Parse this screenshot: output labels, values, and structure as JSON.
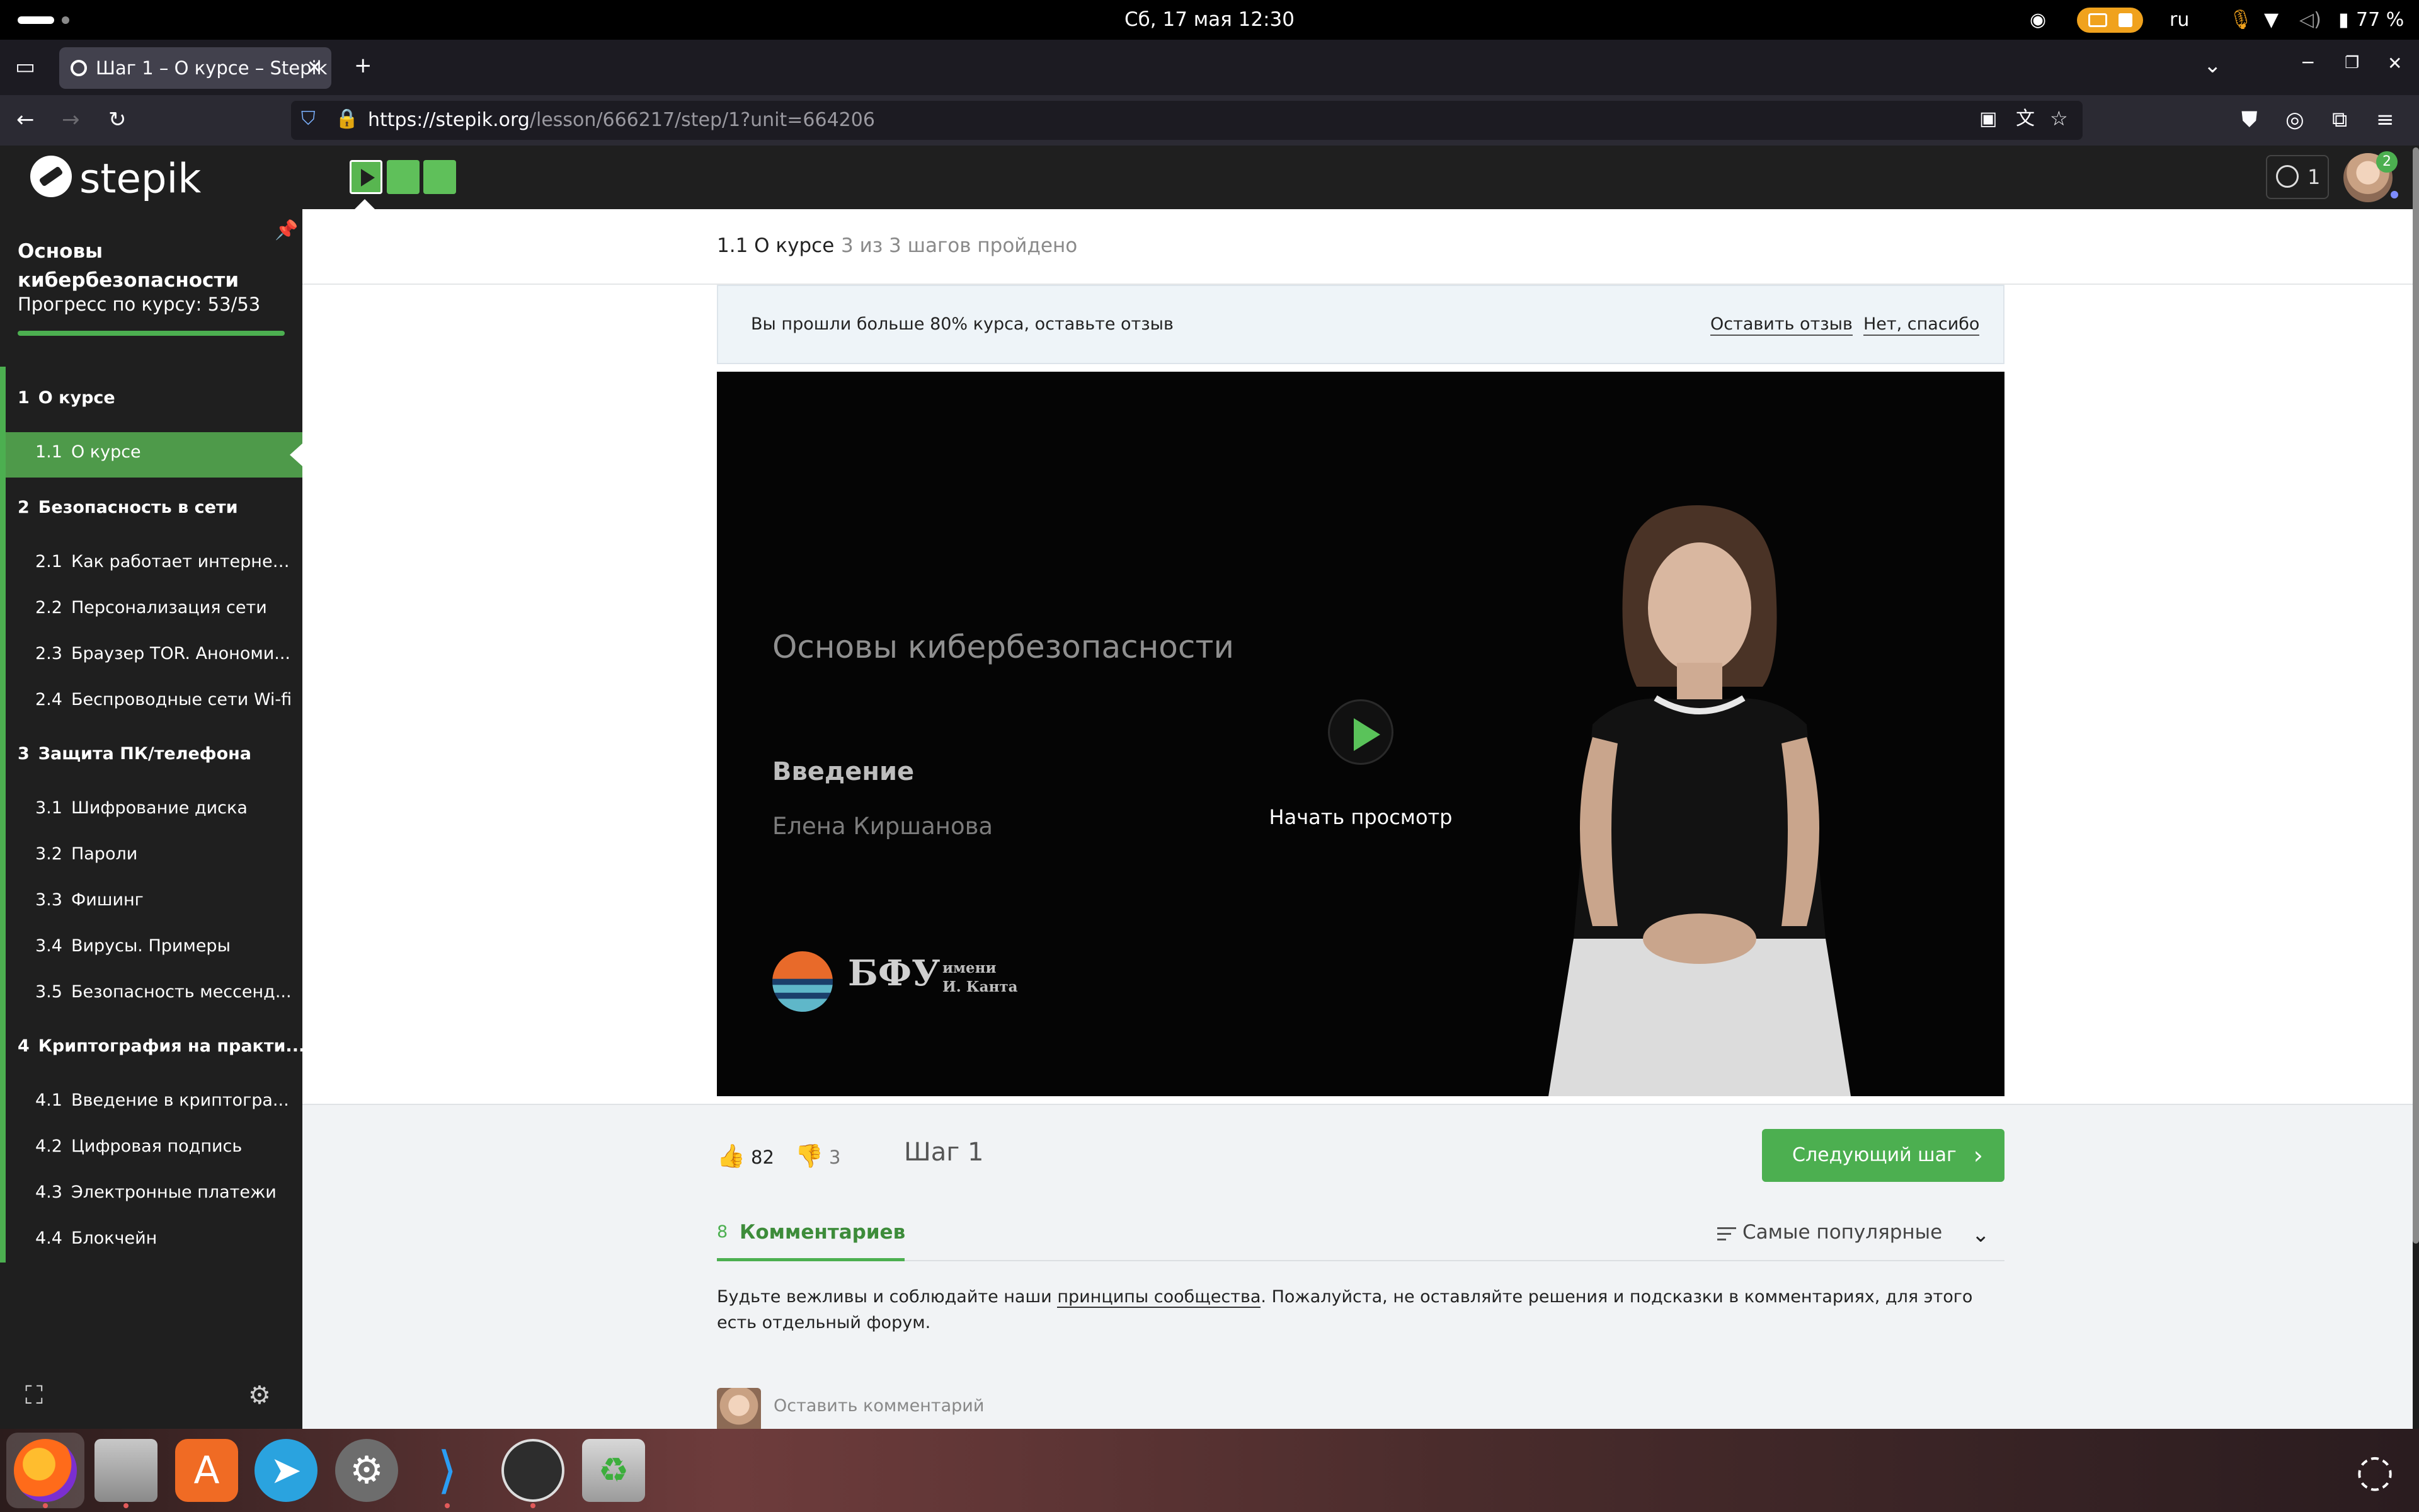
{
  "system": {
    "datetime": "Сб, 17 мая  12:30",
    "language": "ru",
    "battery": "77 %"
  },
  "browser": {
    "tab_title": "Шаг 1 – О курсе – Stepik",
    "url_domain": "https://stepik.org",
    "url_path": "/lesson/666217/step/1?unit=664206"
  },
  "stepik": {
    "logo_text": "stepik",
    "energy_count": "1",
    "notification_count": "2"
  },
  "sidebar": {
    "course_title": "Основы кибербезопасности",
    "progress_label": "Прогресс по курсу:  53/53",
    "progress_fraction": 1.0,
    "sections": [
      {
        "num": "1",
        "title": "О курсе",
        "items": [
          {
            "num": "1.1",
            "title": "О курсе",
            "active": true
          }
        ]
      },
      {
        "num": "2",
        "title": "Безопасность в сети",
        "items": [
          {
            "num": "2.1",
            "title": "Как работает интернет:..."
          },
          {
            "num": "2.2",
            "title": "Персонализация сети"
          },
          {
            "num": "2.3",
            "title": "Браузер TOR. Анономи..."
          },
          {
            "num": "2.4",
            "title": "Беспроводные сети Wi-fi"
          }
        ]
      },
      {
        "num": "3",
        "title": "Защита ПК/телефона",
        "items": [
          {
            "num": "3.1",
            "title": "Шифрование диска"
          },
          {
            "num": "3.2",
            "title": "Пароли"
          },
          {
            "num": "3.3",
            "title": "Фишинг"
          },
          {
            "num": "3.4",
            "title": "Вирусы. Примеры"
          },
          {
            "num": "3.5",
            "title": "Безопасность мессенд..."
          }
        ]
      },
      {
        "num": "4",
        "title": "Криптография на практи...",
        "items": [
          {
            "num": "4.1",
            "title": "Введение в криптогра..."
          },
          {
            "num": "4.2",
            "title": "Цифровая подпись"
          },
          {
            "num": "4.3",
            "title": "Электронные платежи"
          },
          {
            "num": "4.4",
            "title": "Блокчейн"
          }
        ]
      }
    ]
  },
  "lesson": {
    "title": "1.1 О курсе",
    "progress": "3 из 3 шагов пройдено",
    "steps_total": 3,
    "steps_completed": 3,
    "current_step": 1
  },
  "banner": {
    "text": "Вы прошли больше 80% курса, оставьте отзыв",
    "leave_review": "Оставить отзыв",
    "no_thanks": "Нет, спасибо"
  },
  "video": {
    "title": "Основы кибербезопасности",
    "subtitle": "Введение",
    "author": "Елена Киршанова",
    "org_name": "БФУ",
    "org_sub_1": "имени",
    "org_sub_2": "И. Канта",
    "play_label": "Начать просмотр"
  },
  "step_footer": {
    "likes": "82",
    "dislikes": "3",
    "step_label": "Шаг 1",
    "next_button": "Следующий шаг"
  },
  "comments": {
    "count": "8",
    "tab_label": "Комментариев",
    "sort_label": "Самые популярные",
    "rules_before": "Будьте вежливы и соблюдайте наши ",
    "rules_link": "принципы сообщества",
    "rules_after": ". Пожалуйста, не оставляйте решения и подсказки в комментариях, для этого есть отдельный форум.",
    "placeholder": "Оставить комментарий"
  },
  "dock": {
    "apps": [
      "firefox-icon",
      "files-icon",
      "app-center-icon",
      "telegram-icon",
      "settings-icon",
      "vscode-icon",
      "obs-icon",
      "trash-icon"
    ],
    "accent": "#4caf50"
  }
}
